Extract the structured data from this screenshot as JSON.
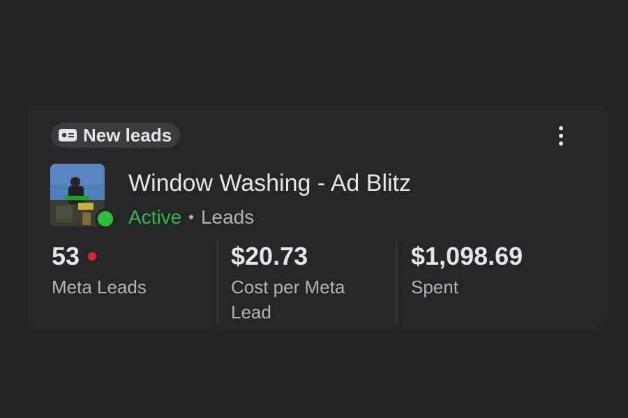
{
  "badge": {
    "icon": "id-card-icon",
    "label": "New leads"
  },
  "menu": {
    "icon": "more-vertical-icon"
  },
  "campaign": {
    "title": "Window Washing - Ad Blitz",
    "status": "Active",
    "status_color": "#38b74a",
    "separator": "•",
    "objective": "Leads"
  },
  "metrics": [
    {
      "value": "53",
      "label": "Meta Leads",
      "alert_dot_color": "#e0242a"
    },
    {
      "value": "$20.73",
      "label_line1": "Cost per Meta",
      "label_line2": "Lead"
    },
    {
      "value": "$1,098.69",
      "label": "Spent"
    }
  ]
}
